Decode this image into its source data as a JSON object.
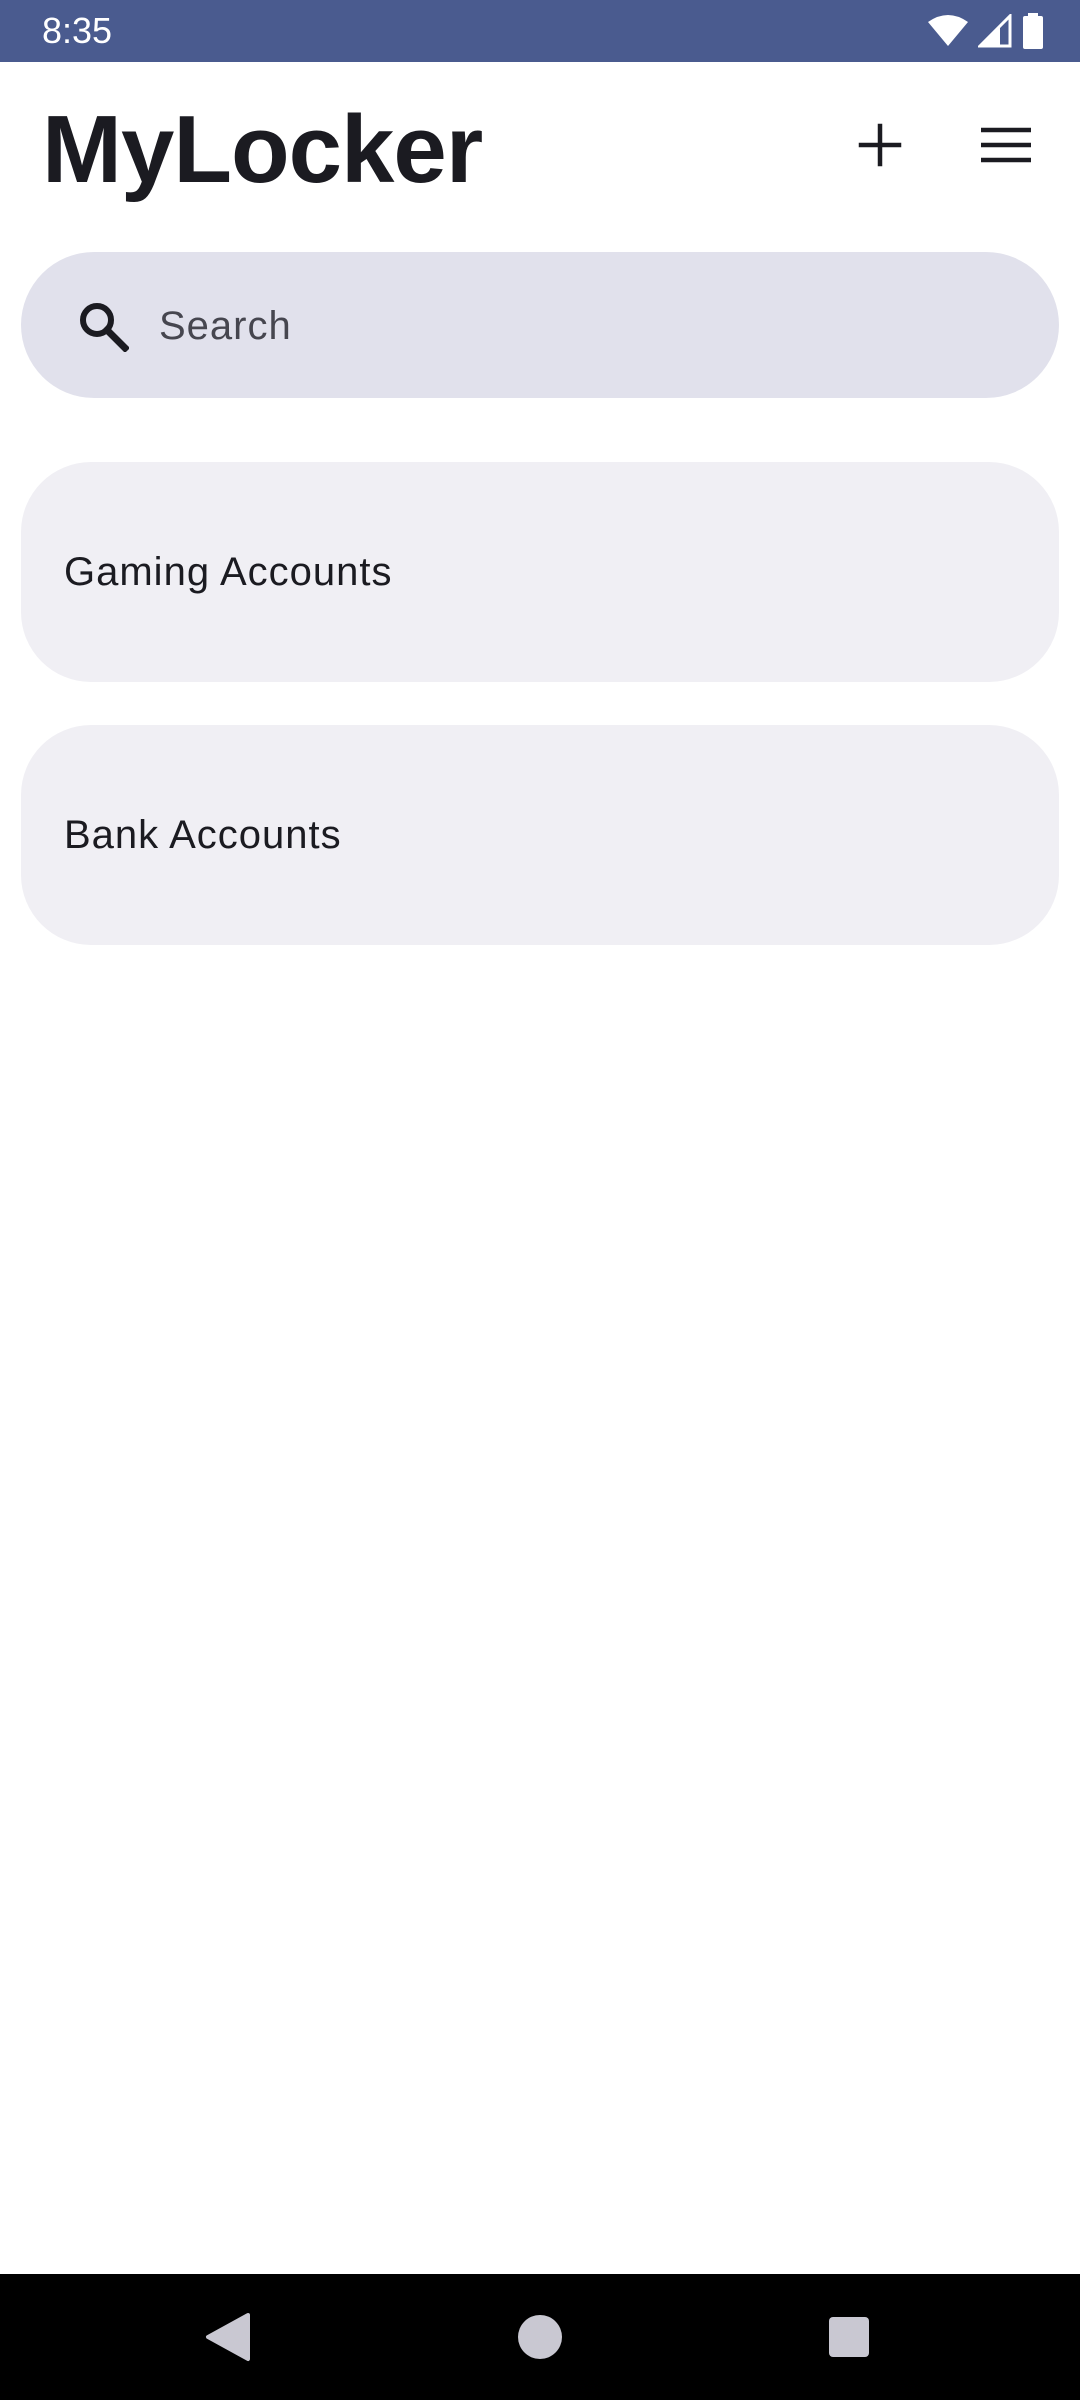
{
  "status_bar": {
    "time": "8:35",
    "icons": [
      "wifi-icon",
      "signal-icon",
      "battery-icon"
    ],
    "background": "#4a5b8f"
  },
  "app_bar": {
    "title": "MyLocker",
    "actions": [
      "add-icon",
      "menu-icon"
    ]
  },
  "search": {
    "placeholder": "Search",
    "value": "",
    "icon": "search-icon"
  },
  "categories": [
    {
      "label": "Gaming Accounts"
    },
    {
      "label": "Bank Accounts"
    }
  ],
  "nav_bar": {
    "buttons": [
      "back-icon",
      "home-icon",
      "recents-icon"
    ]
  },
  "colors": {
    "search_bg": "#e1e1ec",
    "card_bg": "#f0eff4",
    "text": "#1b1b21"
  }
}
